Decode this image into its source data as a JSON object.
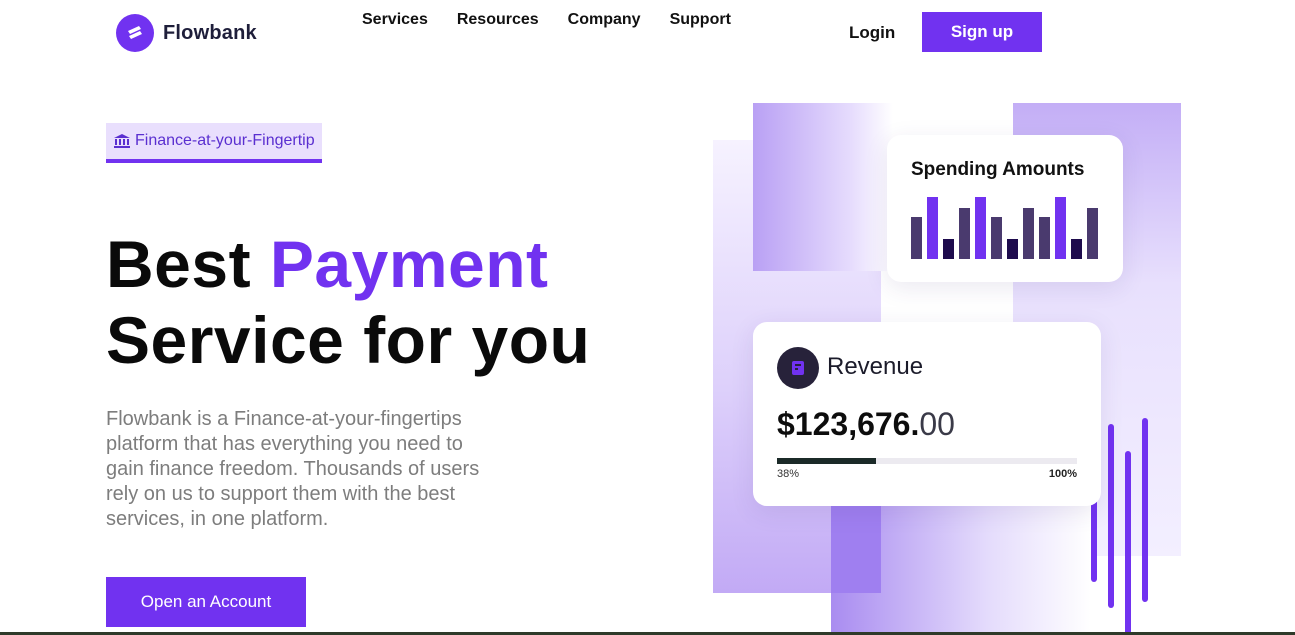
{
  "header": {
    "brand": "Flowbank",
    "nav": [
      "Services",
      "Resources",
      "Company",
      "Support"
    ],
    "login_label": "Login",
    "signup_label": "Sign up"
  },
  "hero": {
    "badge": "Finance-at-your-Fingertip",
    "badge_icon": "bank-icon",
    "title_line1_a": "Best",
    "title_line1_b": "Payment",
    "title_line2": "Service for you",
    "description": "Flowbank is a Finance-at-your-fingertips platform that has everything you need to gain finance freedom. Thousands of users rely on us to support them with the best services, in one platform.",
    "cta_label": "Open an Account"
  },
  "spending_card": {
    "title": "Spending Amounts",
    "bars": [
      {
        "value": 0.67,
        "color": "#4a3a6e"
      },
      {
        "value": 1.0,
        "color": "#7132f0"
      },
      {
        "value": 0.32,
        "color": "#1e0b4d"
      },
      {
        "value": 0.83,
        "color": "#4a3a6e"
      },
      {
        "value": 1.0,
        "color": "#7132f0"
      },
      {
        "value": 0.67,
        "color": "#4a3a6e"
      },
      {
        "value": 0.32,
        "color": "#1e0b4d"
      },
      {
        "value": 0.83,
        "color": "#4a3a6e"
      },
      {
        "value": 0.67,
        "color": "#4a3a6e"
      },
      {
        "value": 1.0,
        "color": "#7132f0"
      },
      {
        "value": 0.32,
        "color": "#1e0b4d"
      },
      {
        "value": 0.83,
        "color": "#4a3a6e"
      }
    ]
  },
  "revenue_card": {
    "title": "Revenue",
    "icon": "receipt-icon",
    "amount_main": "$123,676.",
    "amount_cents": "00",
    "progress_label_left": "38%",
    "progress_label_right": "100%",
    "progress": 0.33
  },
  "colors": {
    "accent": "#7132f0",
    "badge_bg": "#e9dffd",
    "text_muted": "#7d7d7d"
  }
}
